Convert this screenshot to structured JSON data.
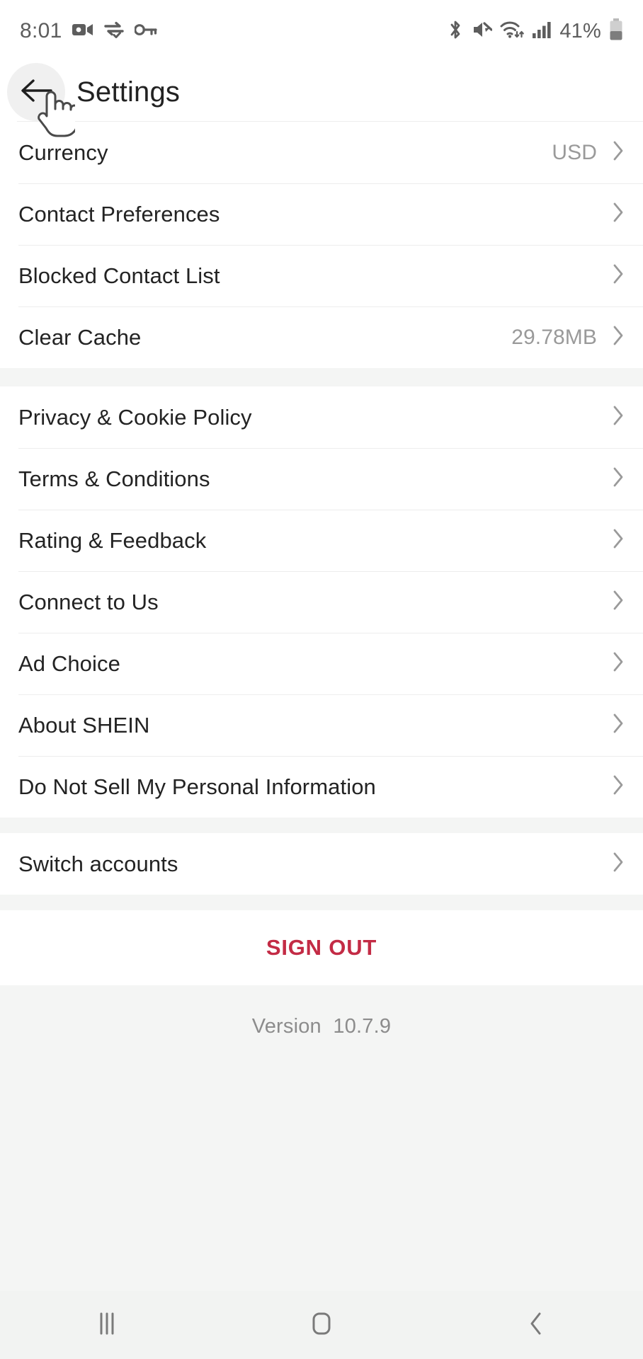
{
  "status_bar": {
    "time": "8:01",
    "left_icons": [
      "video-camera-icon",
      "data-sync-icon",
      "vpn-key-icon"
    ],
    "right_icons": [
      "bluetooth-icon",
      "volume-mute-icon",
      "wifi-icon",
      "cellular-signal-icon"
    ],
    "battery_percent": "41%",
    "battery_icon": "battery-icon",
    "text_color": "#5d5d5d"
  },
  "header": {
    "back_icon": "back-arrow-icon",
    "title": "Settings",
    "cursor_icon": "pointing-hand-cursor"
  },
  "groups": [
    {
      "name": "preferences-group",
      "rows": [
        {
          "label": "Currency",
          "value": "USD",
          "chevron": "chevron-right-icon"
        },
        {
          "label": "Contact Preferences",
          "value": "",
          "chevron": "chevron-right-icon"
        },
        {
          "label": "Blocked Contact List",
          "value": "",
          "chevron": "chevron-right-icon"
        },
        {
          "label": "Clear Cache",
          "value": "29.78MB",
          "chevron": "chevron-right-icon"
        }
      ]
    },
    {
      "name": "legal-group",
      "rows": [
        {
          "label": "Privacy & Cookie Policy",
          "value": "",
          "chevron": "chevron-right-icon"
        },
        {
          "label": "Terms & Conditions",
          "value": "",
          "chevron": "chevron-right-icon"
        },
        {
          "label": "Rating & Feedback",
          "value": "",
          "chevron": "chevron-right-icon"
        },
        {
          "label": "Connect to Us",
          "value": "",
          "chevron": "chevron-right-icon"
        },
        {
          "label": "Ad Choice",
          "value": "",
          "chevron": "chevron-right-icon"
        },
        {
          "label": "About SHEIN",
          "value": "",
          "chevron": "chevron-right-icon"
        },
        {
          "label": "Do Not Sell My Personal Information",
          "value": "",
          "chevron": "chevron-right-icon"
        }
      ]
    },
    {
      "name": "account-group",
      "rows": [
        {
          "label": "Switch accounts",
          "value": "",
          "chevron": "chevron-right-icon"
        }
      ]
    }
  ],
  "sign_out": {
    "label": "SIGN OUT",
    "color": "#c32b45"
  },
  "footer": {
    "version_text": "Version  10.7.9",
    "color": "#8c8c8c"
  },
  "nav_bar": {
    "recents_icon": "recents-icon",
    "home_icon": "home-icon",
    "back_icon": "nav-back-icon",
    "color": "#7a7a7a"
  },
  "colors": {
    "background": "#ffffff",
    "section_gap": "#f4f5f4",
    "divider": "#ededed",
    "label": "#232323",
    "value": "#9a9a9a",
    "accent_red": "#c32b45"
  }
}
